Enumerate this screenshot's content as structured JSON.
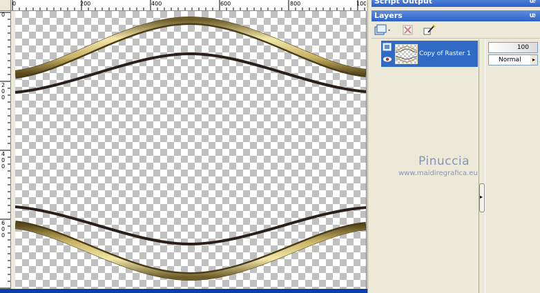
{
  "rulers": {
    "top_labels": [
      "0",
      "200",
      "400",
      "600",
      "800",
      "100"
    ],
    "left_labels": [
      "0",
      "2",
      "0",
      "0",
      "4",
      "0",
      "0",
      "6",
      "0",
      "0"
    ]
  },
  "panels": {
    "script_output_title": "Script Output",
    "layers_title": "Layers"
  },
  "layers": {
    "items": [
      {
        "name": "Copy of Raster 1",
        "selected": true
      }
    ]
  },
  "properties": {
    "opacity": "100",
    "blend_mode": "Normal"
  },
  "watermark": {
    "title": "Pinuccia",
    "url": "www.maidiregrafica.eu"
  },
  "colors": {
    "titlebar": "#3a6fd0",
    "selection": "#316ac5",
    "gold": "#c8b468",
    "dark_line": "#2a1f1a"
  },
  "icons": [
    "new-layer-icon",
    "delete-layer-icon",
    "edit-layer-icon",
    "pin-icon",
    "visibility-eye-icon",
    "layer-type-icon",
    "collapse-arrow-icon"
  ]
}
